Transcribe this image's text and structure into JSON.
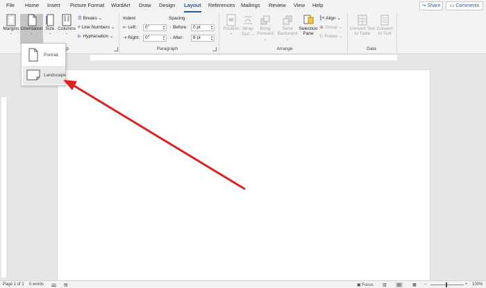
{
  "tabs": {
    "file": "File",
    "home": "Home",
    "insert": "Insert",
    "picture_format": "Picture Format",
    "wordart": "WordArt",
    "draw": "Draw",
    "design": "Design",
    "layout": "Layout",
    "references": "References",
    "mailings": "Mailings",
    "review": "Review",
    "view": "View",
    "help": "Help"
  },
  "header_buttons": {
    "share": "Share",
    "comments": "Comments"
  },
  "page_setup": {
    "margins": "Margins",
    "orientation": "Orientation",
    "size": "Size",
    "columns": "Columns",
    "breaks": "Breaks",
    "line_numbers": "Line Numbers",
    "hyphenation": "Hyphenation",
    "group_label_fragment": "p"
  },
  "paragraph": {
    "indent_title": "Indent",
    "spacing_title": "Spacing",
    "left_label": "Left:",
    "left_value": "0\"",
    "right_label": "Right:",
    "right_value": "0\"",
    "before_label": "Before:",
    "before_value": "0 pt",
    "after_label": "After:",
    "after_value": "8 pt",
    "group_label": "Paragraph"
  },
  "arrange": {
    "position": "Position",
    "wrap": "Wrap",
    "wrap2": "Text",
    "bring": "Bring",
    "bring2": "Forward",
    "send": "Send",
    "send2": "Backward",
    "selection": "Selection",
    "selection2": "Pane",
    "align": "Align",
    "group": "Group",
    "rotate": "Rotate",
    "group_label": "Arrange"
  },
  "data_group": {
    "convert_to_table": "Convert Text",
    "convert_to_table2": "to Table",
    "convert_to_text": "Convert",
    "convert_to_text2": "to Text",
    "group_label": "Data"
  },
  "orientation_menu": {
    "portrait": "Portrait",
    "landscape": "Landscape"
  },
  "status": {
    "page": "Page 1 of 1",
    "words": "0 words",
    "focus": "Focus",
    "zoom": "100%"
  },
  "colors": {
    "accent": "#2b579a",
    "arrow": "#e02020",
    "selection": "#f6c343"
  }
}
